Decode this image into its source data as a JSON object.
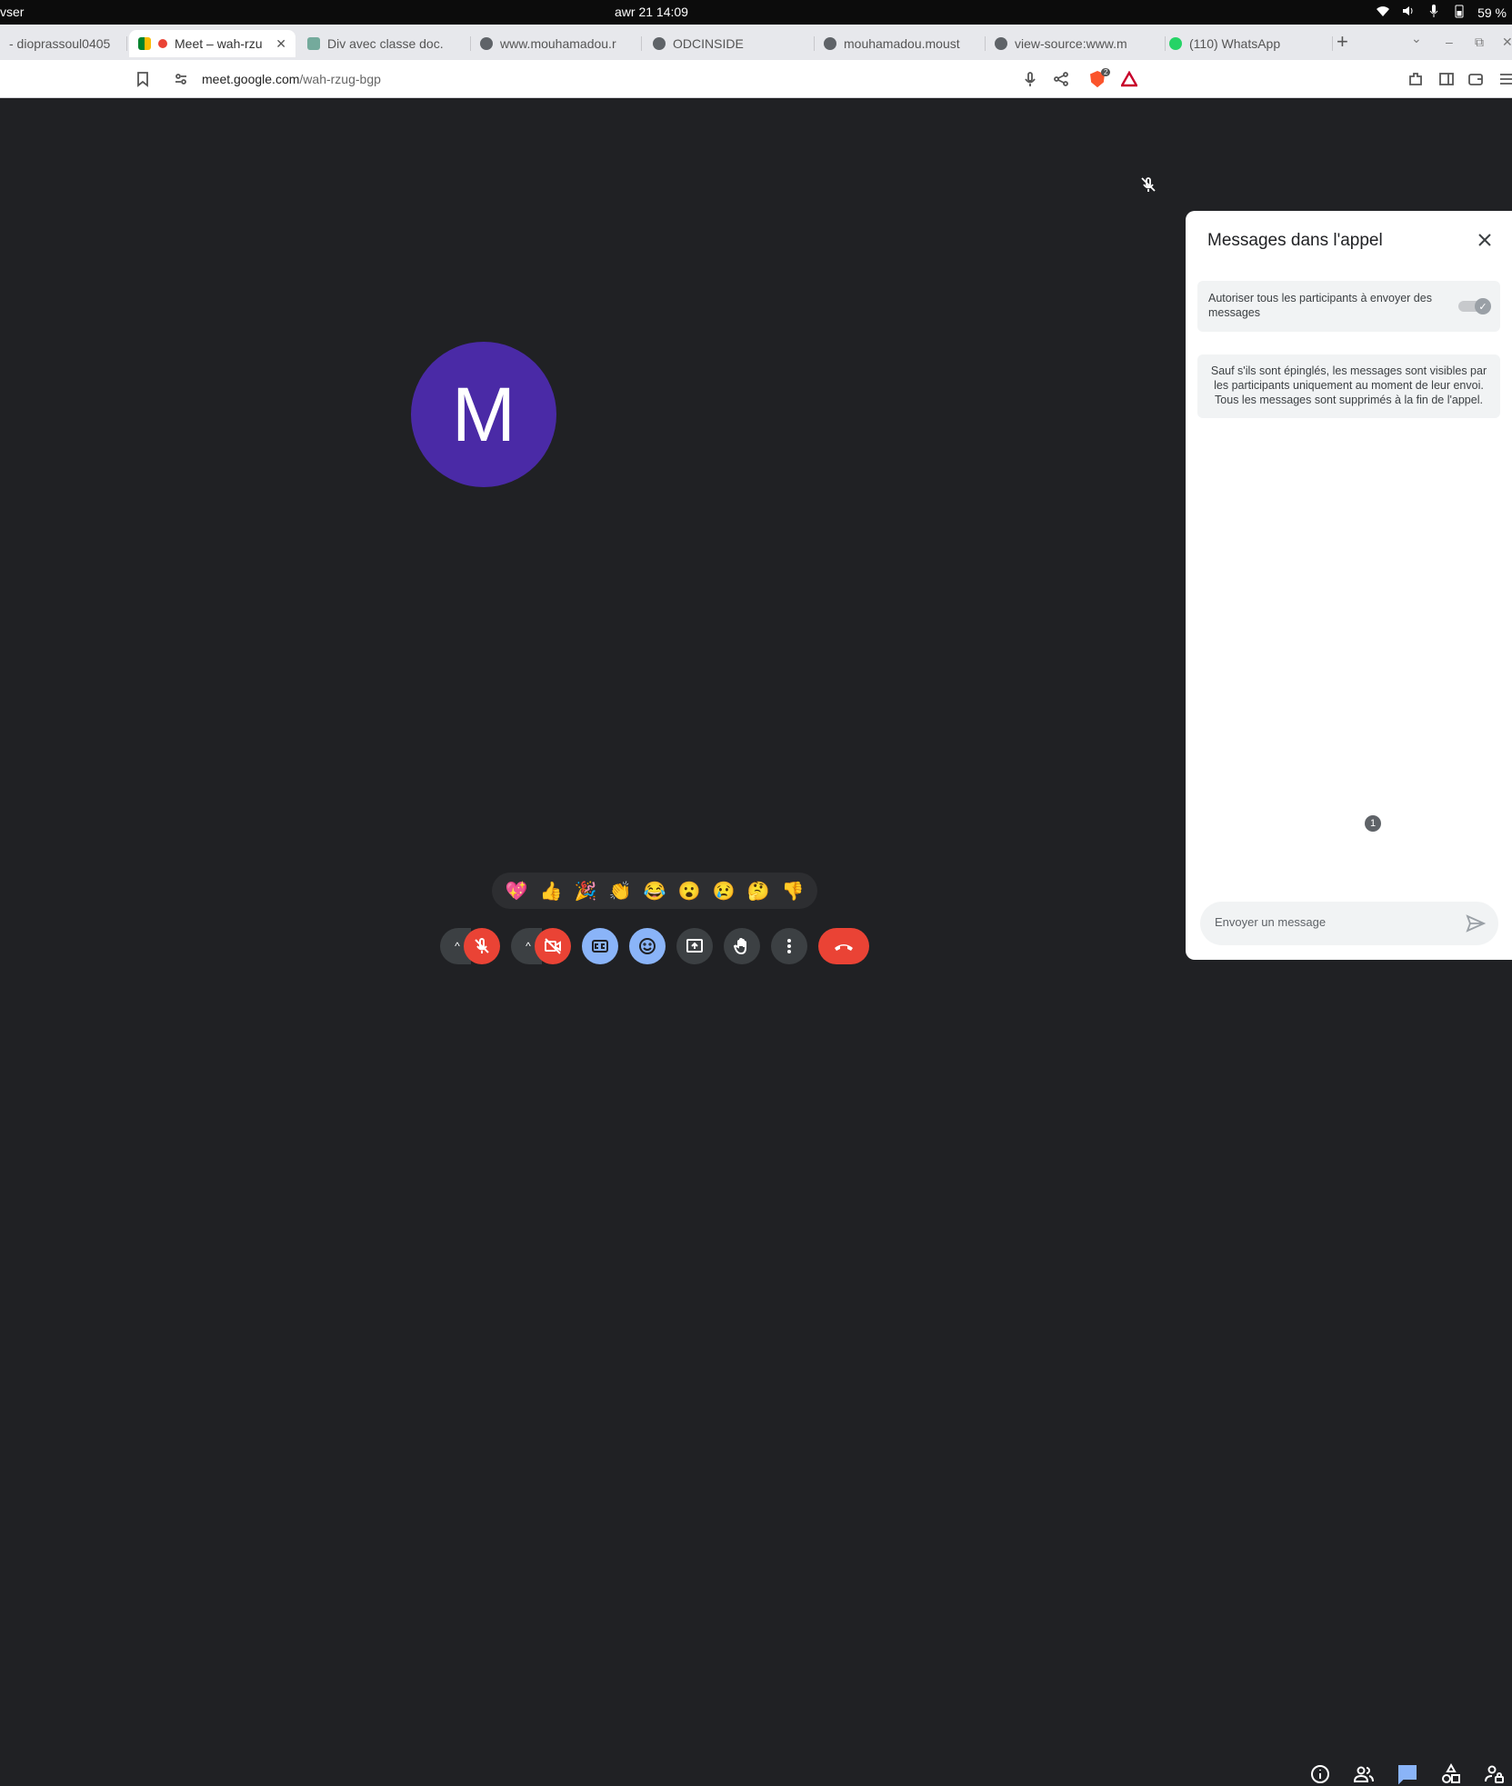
{
  "system_bar": {
    "left_text": "vser",
    "clock": "awr 21  14:09",
    "battery": "59 %",
    "tray_icons": [
      "wifi-icon",
      "volume-icon",
      "mic-icon",
      "battery-icon"
    ]
  },
  "tabs": [
    {
      "label": "- dioprassoul0405",
      "favicon": "mail-icon",
      "active": false
    },
    {
      "label": "Meet – wah-rzu",
      "favicon": "meet-icon",
      "active": true,
      "recording": true
    },
    {
      "label": "Div avec classe doc.",
      "favicon": "chatgpt-icon",
      "active": false
    },
    {
      "label": "www.mouhamadou.r",
      "favicon": "globe-icon",
      "active": false
    },
    {
      "label": "ODCINSIDE",
      "favicon": "globe-icon",
      "active": false
    },
    {
      "label": "mouhamadou.moust",
      "favicon": "globe-icon",
      "active": false
    },
    {
      "label": "view-source:www.m",
      "favicon": "globe-icon",
      "active": false
    },
    {
      "label": "(110) WhatsApp",
      "favicon": "whatsapp-icon",
      "active": false
    }
  ],
  "tab_close": "✕",
  "new_tab": "+",
  "address": {
    "host": "meet.google.com",
    "path": "/wah-rzug-bgp"
  },
  "brave_badge": "2",
  "participant": {
    "initial": "M",
    "color": "#4a2aa6"
  },
  "chat_panel": {
    "title": "Messages dans l'appel",
    "allow_label": "Autoriser tous les participants à envoyer des messages",
    "allow_enabled": true,
    "info_text": "Sauf s'ils sont épinglés, les messages sont visibles par les participants uniquement au moment de leur envoi. Tous les messages sont supprimés à la fin de l'appel.",
    "input_placeholder": "Envoyer un message"
  },
  "reactions": [
    "💖",
    "👍",
    "🎉",
    "👏",
    "😂",
    "😮",
    "😢",
    "🤔",
    "👎"
  ],
  "controls": {
    "mic_muted": true,
    "camera_off": true,
    "people_count": "1"
  },
  "colors": {
    "stage_bg": "#202124",
    "danger": "#ea4335",
    "accent_blue": "#8ab4f8"
  }
}
